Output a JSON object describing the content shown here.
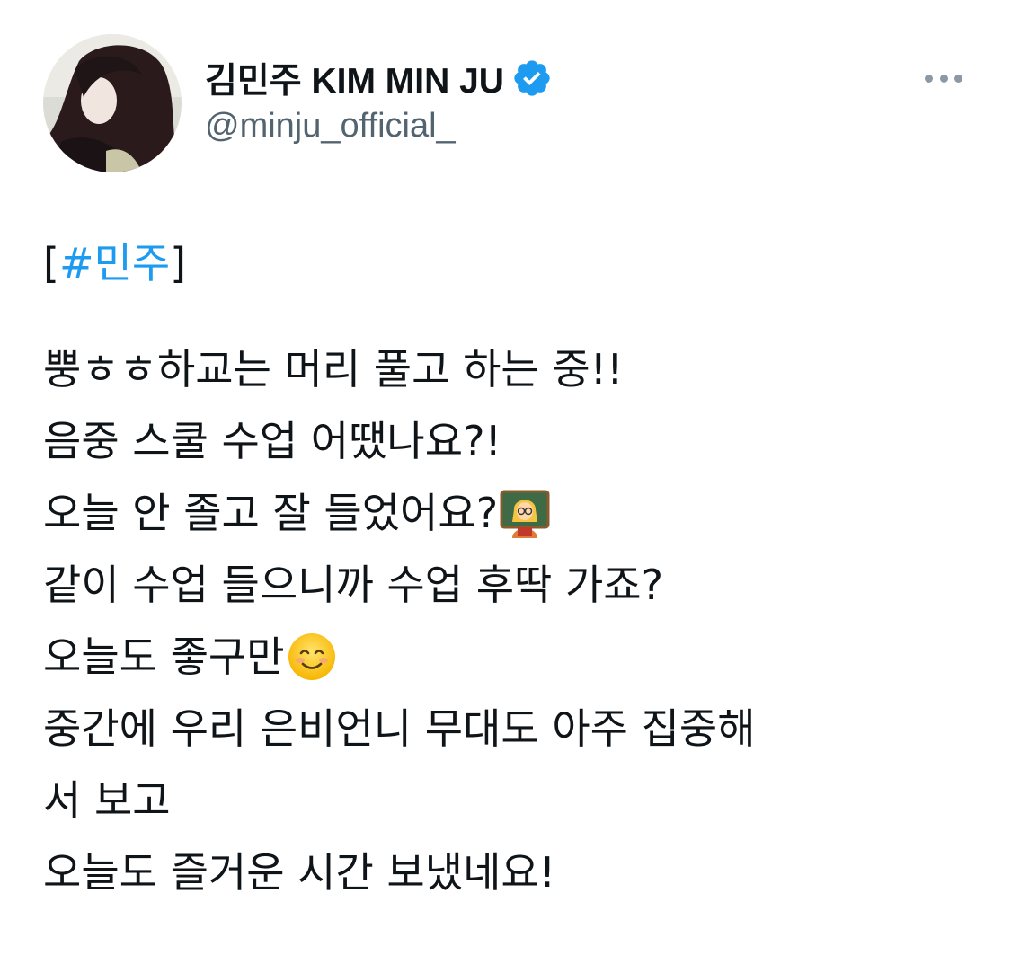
{
  "author": {
    "display_name": "김민주 KIM MIN JU",
    "handle": "@minju_official_",
    "verified": true,
    "avatar": "profile-photo"
  },
  "menu_icon": "more-horizontal-icon",
  "tweet": {
    "bracket_open": "[",
    "hashtag": "#민주",
    "bracket_close": "]",
    "lines": [
      "뿡ㅎㅎ하교는 머리 풀고 하는 중!!",
      "음중 스쿨 수업 어땠나요?!",
      "오늘 안 졸고 잘 들었어요?",
      "같이 수업 들으니까 수업 후딱 가죠?",
      "오늘도 좋구만",
      "중간에 우리 은비언니 무대도 아주 집중해",
      "서 보고",
      "오늘도 즐거운 시간 보냈네요!"
    ],
    "emoji": {
      "teacher": "woman-teacher-emoji",
      "smile": "smiling-face-emoji"
    }
  },
  "colors": {
    "text": "#0f1419",
    "secondary": "#536471",
    "link": "#1d9bf0",
    "verified": "#1d9bf0"
  }
}
